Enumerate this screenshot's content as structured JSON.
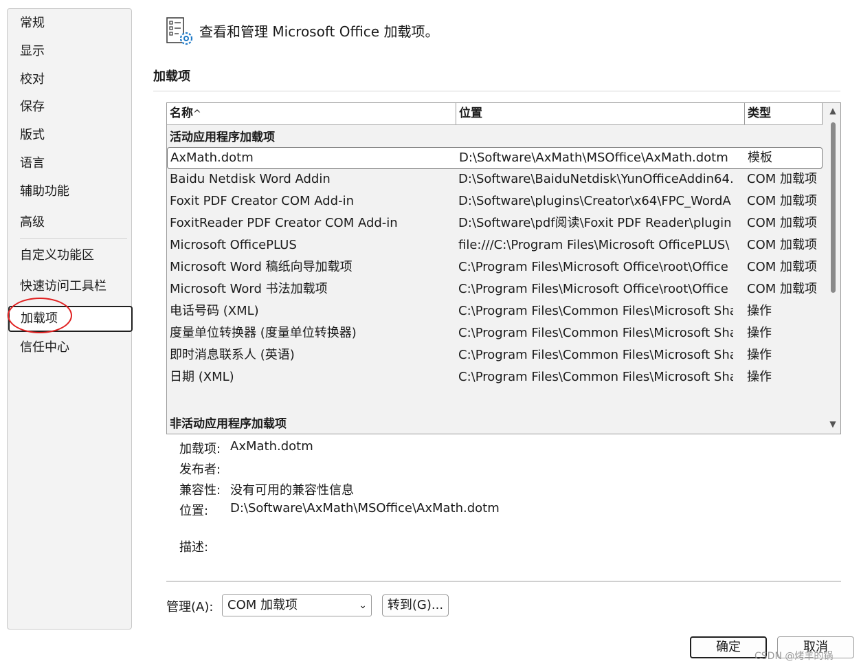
{
  "sidebar": {
    "items": [
      {
        "label": "常规"
      },
      {
        "label": "显示"
      },
      {
        "label": "校对"
      },
      {
        "label": "保存"
      },
      {
        "label": "版式"
      },
      {
        "label": "语言"
      },
      {
        "label": "辅助功能"
      },
      {
        "label": "高级"
      },
      {
        "label": "自定义功能区"
      },
      {
        "label": "快速访问工具栏"
      },
      {
        "label": "加载项",
        "selected": true
      },
      {
        "label": "信任中心"
      }
    ]
  },
  "header": {
    "title": "查看和管理 Microsoft Office 加载项。",
    "icon": "addins-gear-icon"
  },
  "section": {
    "title": "加载项"
  },
  "addins": {
    "columns": {
      "name": "名称",
      "sort_indicator": "^",
      "location": "位置",
      "type": "类型"
    },
    "active_group_label": "活动应用程序加载项",
    "inactive_group_label": "非活动应用程序加载项",
    "rows": [
      {
        "name": "AxMath.dotm",
        "location": "D:\\Software\\AxMath\\MSOffice\\AxMath.dotm",
        "type": "模板",
        "selected": true
      },
      {
        "name": "Baidu Netdisk Word Addin",
        "location": "D:\\Software\\BaiduNetdisk\\YunOfficeAddin64.",
        "type": "COM 加载项"
      },
      {
        "name": "Foxit PDF Creator COM Add-in",
        "location": "D:\\Software\\plugins\\Creator\\x64\\FPC_WordA",
        "type": "COM 加载项"
      },
      {
        "name": "FoxitReader PDF Creator COM Add-in",
        "location": "D:\\Software\\pdf阅读\\Foxit PDF Reader\\plugin",
        "type": "COM 加载项"
      },
      {
        "name": "Microsoft OfficePLUS",
        "location": "file:///C:\\Program Files\\Microsoft OfficePLUS\\",
        "type": "COM 加载项"
      },
      {
        "name": "Microsoft Word 稿纸向导加载项",
        "location": "C:\\Program Files\\Microsoft Office\\root\\Office",
        "type": "COM 加载项"
      },
      {
        "name": "Microsoft Word 书法加载项",
        "location": "C:\\Program Files\\Microsoft Office\\root\\Office",
        "type": "COM 加载项"
      },
      {
        "name": "电话号码 (XML)",
        "location": "C:\\Program Files\\Common Files\\Microsoft Sha",
        "type": "操作"
      },
      {
        "name": "度量单位转换器 (度量单位转换器)",
        "location": "C:\\Program Files\\Common Files\\Microsoft Sha",
        "type": "操作"
      },
      {
        "name": "即时消息联系人 (英语)",
        "location": "C:\\Program Files\\Common Files\\Microsoft Sha",
        "type": "操作"
      },
      {
        "name": "日期 (XML)",
        "location": "C:\\Program Files\\Common Files\\Microsoft Sha",
        "type": "操作"
      }
    ]
  },
  "details": {
    "addin_label": "加载项:",
    "addin_value": "AxMath.dotm",
    "publisher_label": "发布者:",
    "publisher_value": "",
    "compat_label": "兼容性:",
    "compat_value": "没有可用的兼容性信息",
    "location_label": "位置:",
    "location_value": "D:\\Software\\AxMath\\MSOffice\\AxMath.dotm",
    "description_label": "描述:"
  },
  "manage": {
    "label": "管理(A):",
    "selected": "COM 加载项",
    "go_button": "转到(G)..."
  },
  "dialog": {
    "ok_button": "确定",
    "cancel_button": "取消"
  },
  "watermark": "CSDN @烤羊的锅",
  "colors": {
    "annotation_circle": "#e02020",
    "sidebar_bg": "#f3f3f3",
    "list_bg": "#f2f2f2"
  }
}
